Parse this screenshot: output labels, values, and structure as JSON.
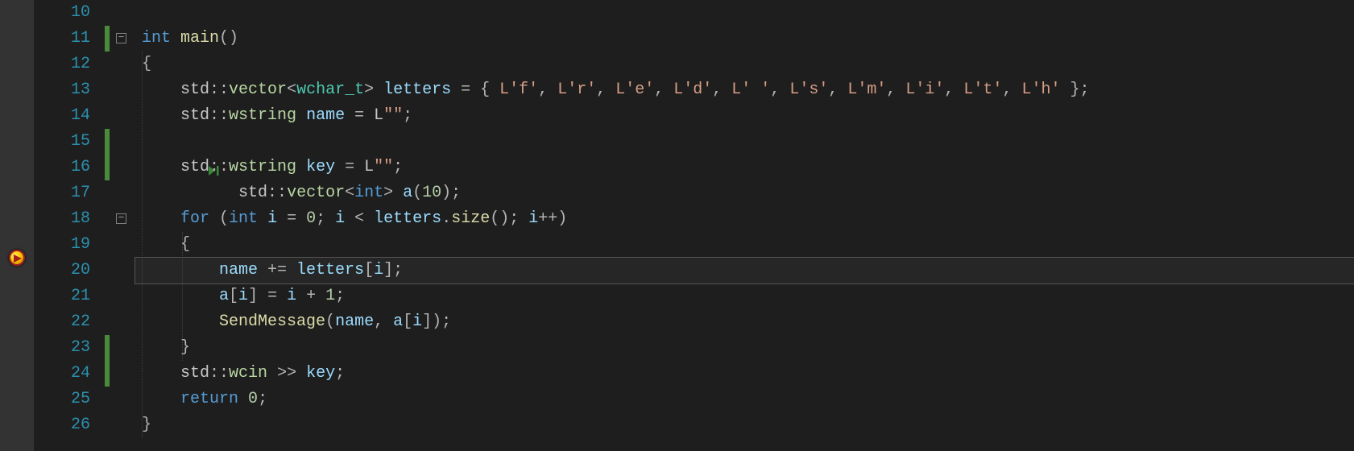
{
  "lines": {
    "start": 10,
    "end": 26,
    "current": 20,
    "changed_ranges": [
      [
        11,
        11
      ],
      [
        15,
        16
      ],
      [
        23,
        24
      ]
    ],
    "fold_points": [
      {
        "line": 11,
        "symbol": "−"
      },
      {
        "line": 18,
        "symbol": "−"
      }
    ]
  },
  "code": {
    "l10": "",
    "l11_int": "int",
    "l11_main": "main",
    "l11_paren": "()",
    "l12_brace": "{",
    "l13_std": "std",
    "l13_cc": "::",
    "l13_vector": "vector",
    "l13_lt": "<",
    "l13_wchar": "wchar_t",
    "l13_gt": ">",
    "l13_letters": " letters ",
    "l13_eq": "=",
    "l13_open": " { ",
    "l13_Lf": "L'f'",
    "l13_c": ", ",
    "l13_Lr": "L'r'",
    "l13_Le": "L'e'",
    "l13_Ld": "L'd'",
    "l13_Lsp": "L' '",
    "l13_Ls": "L's'",
    "l13_Lm": "L'm'",
    "l13_Li": "L'i'",
    "l13_Lt": "L't'",
    "l13_Lh": "L'h'",
    "l13_close": " };",
    "l14_std": "std",
    "l14_cc": "::",
    "l14_wstring": "wstring",
    "l14_name": " name ",
    "l14_eq": "=",
    "l14_L": " L",
    "l14_str": "\"\"",
    "l14_semi": ";",
    "l15_std": "std",
    "l15_cc": "::",
    "l15_vector": "vector",
    "l15_lt": "<",
    "l15_int": "int",
    "l15_gt": ">",
    "l15_a": " a",
    "l15_open": "(",
    "l15_10": "10",
    "l15_close": ");",
    "l16_std": "std",
    "l16_cc": "::",
    "l16_wstring": "wstring",
    "l16_key": " key ",
    "l16_eq": "=",
    "l16_L": " L",
    "l16_str": "\"\"",
    "l16_semi": ";",
    "l18_for": "for",
    "l18_open": " (",
    "l18_int": "int",
    "l18_i1": " i ",
    "l18_eq": "=",
    "l18_sp": " ",
    "l18_0": "0",
    "l18_semi1": "; ",
    "l18_i2": "i ",
    "l18_lt": "<",
    "l18_letters": " letters",
    "l18_dot": ".",
    "l18_size": "size",
    "l18_paren": "(); ",
    "l18_i3": "i",
    "l18_pp": "++)",
    "l19_brace": "{",
    "l20_name": "name ",
    "l20_pe": "+=",
    "l20_letters": " letters",
    "l20_br1": "[",
    "l20_i": "i",
    "l20_br2": "];",
    "l21_a": "a",
    "l21_br1": "[",
    "l21_i1": "i",
    "l21_br2": "] ",
    "l21_eq": "=",
    "l21_i2": " i ",
    "l21_plus": "+",
    "l21_sp": " ",
    "l21_1": "1",
    "l21_semi": ";",
    "l22_send": "SendMessage",
    "l22_open": "(",
    "l22_name": "name",
    "l22_c": ", ",
    "l22_a": "a",
    "l22_br1": "[",
    "l22_i": "i",
    "l22_br2": "]);",
    "l23_brace": "}",
    "l24_std": "std",
    "l24_cc": "::",
    "l24_wcin": "wcin",
    "l24_op": " >> ",
    "l24_key": "key",
    "l24_semi": ";",
    "l25_return": "return",
    "l25_sp": " ",
    "l25_0": "0",
    "l25_semi": ";",
    "l26_brace": "}"
  },
  "line_labels": {
    "10": "10",
    "11": "11",
    "12": "12",
    "13": "13",
    "14": "14",
    "15": "15",
    "16": "16",
    "17": "17",
    "18": "18",
    "19": "19",
    "20": "20",
    "21": "21",
    "22": "22",
    "23": "23",
    "24": "24",
    "25": "25",
    "26": "26"
  }
}
